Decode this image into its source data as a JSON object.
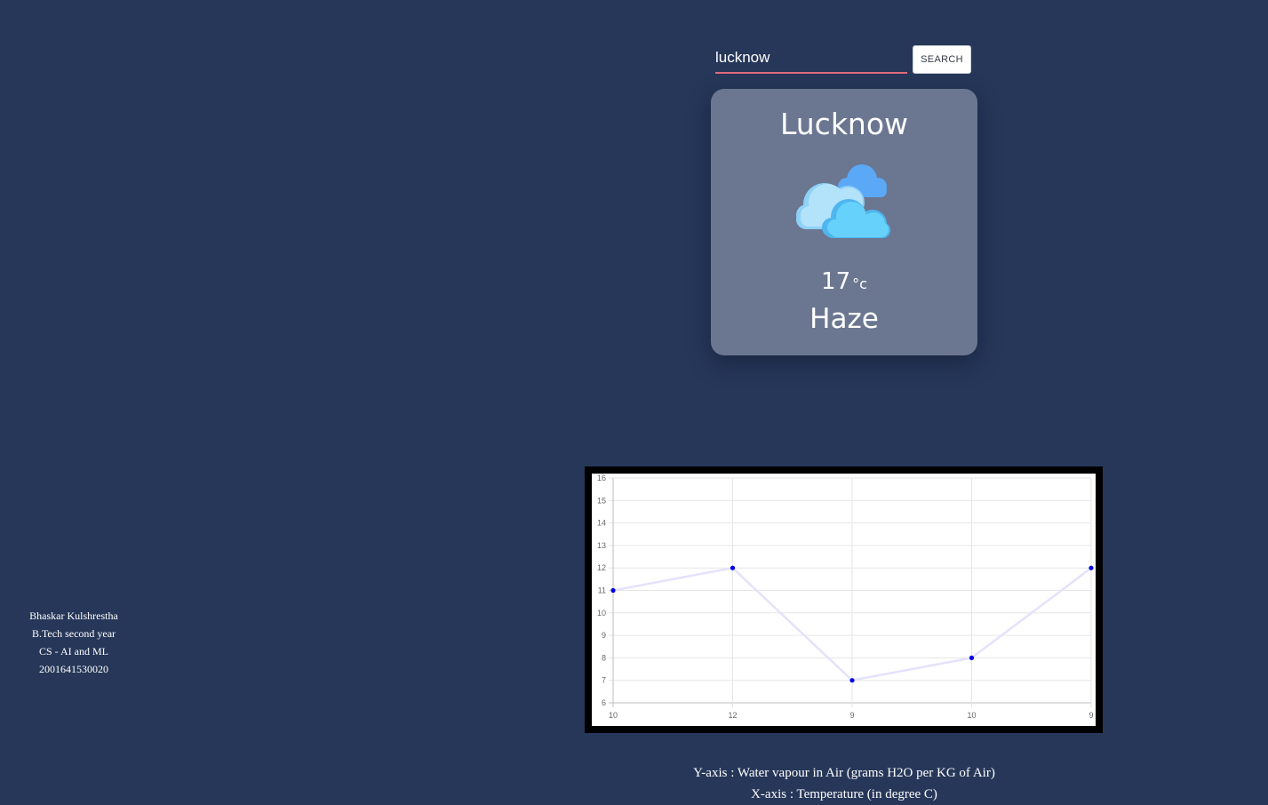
{
  "search": {
    "value": "lucknow",
    "button_label": "SEARCH"
  },
  "weather": {
    "city": "Lucknow",
    "temperature": "17",
    "unit": "°c",
    "condition": "Haze",
    "icon": "clouds-icon"
  },
  "author": {
    "name": "Bhaskar Kulshrestha",
    "course": "B.Tech second year",
    "branch": "CS - AI and ML",
    "roll": "2001641530020"
  },
  "captions": {
    "y_axis": "Y-axis : Water vapour in Air (grams H2O per KG of Air)",
    "x_axis": "X-axis : Temperature (in degree C)"
  },
  "colors": {
    "background": "#263759",
    "card": "#6b7690",
    "input_underline": "#e36a7c",
    "line": "#e4e2fb",
    "points": "#0000ee"
  },
  "chart_data": {
    "type": "line",
    "categories": [
      "10",
      "12",
      "9",
      "10",
      "9"
    ],
    "values": [
      11,
      12,
      7,
      8,
      12
    ],
    "ylim": [
      6,
      16
    ],
    "y_ticks": [
      6,
      7,
      8,
      9,
      10,
      11,
      12,
      13,
      14,
      15,
      16
    ],
    "grid": true
  }
}
